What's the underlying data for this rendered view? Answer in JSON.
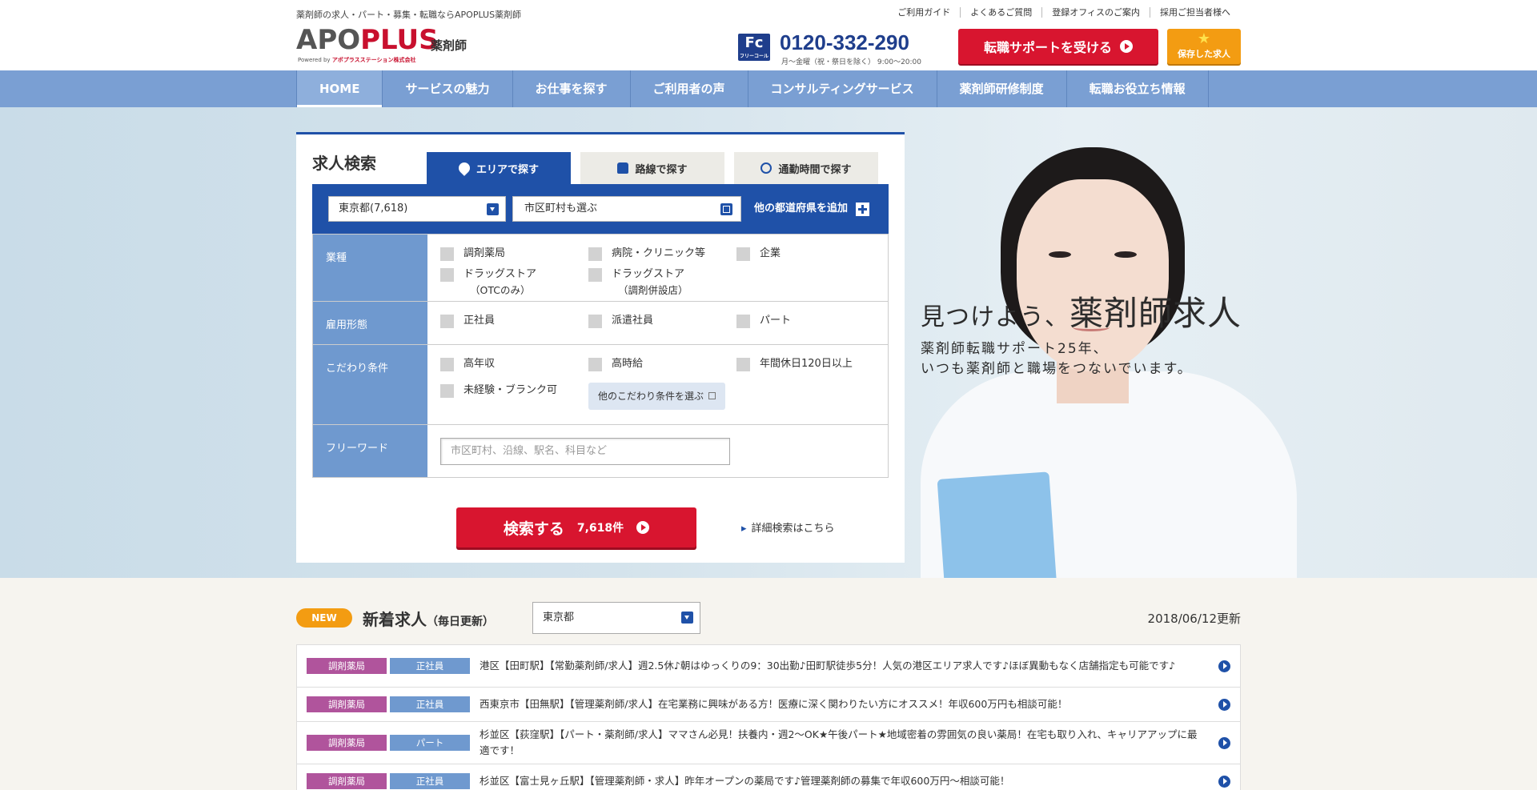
{
  "header": {
    "tagline": "薬剤師の求人・パート・募集・転職ならAPOPLUS薬剤師",
    "logo_prefix": "APO",
    "logo_plus": "PLUS",
    "logo_sub": "薬剤師",
    "logo_powered": "Powered by",
    "logo_company": "アポプラスステーション株式会社",
    "util_links": [
      "ご利用ガイド",
      "よくあるご質問",
      "登録オフィスのご案内",
      "採用ご担当者様へ"
    ],
    "phone_badge": "Fc",
    "phone_badge_sub": "フリーコール",
    "phone_number": "0120-332-290",
    "phone_hours": "月～金曜（祝・祭日を除く） 9:00～20:00",
    "support_button": "転職サポートを受ける",
    "saved_button": "保存した求人"
  },
  "nav": {
    "items": [
      "HOME",
      "サービスの魅力",
      "お仕事を探す",
      "ご利用者の声",
      "コンサルティングサービス",
      "薬剤師研修制度",
      "転職お役立ち情報"
    ]
  },
  "hero": {
    "catch_small": "見つけよう、",
    "catch_big": "薬剤師求人",
    "text_line1": "薬剤師転職サポート25年、",
    "text_line2": "いつも薬剤師と職場をつないでいます。"
  },
  "search": {
    "title": "求人検索",
    "tabs": [
      "エリアで探す",
      "路線で探す",
      "通勤時間で探す"
    ],
    "pref_value": "東京都(7,618)",
    "city_value": "市区町村も選ぶ",
    "add_pref": "他の都道府県を追加",
    "rows": {
      "industry": {
        "label": "業種",
        "options": [
          "調剤薬局",
          "病院・クリニック等",
          "企業",
          "ドラッグストア",
          "ドラッグストア"
        ],
        "option_subs": [
          "（OTCのみ）",
          "（調剤併設店）"
        ]
      },
      "employment": {
        "label": "雇用形態",
        "options": [
          "正社員",
          "派遣社員",
          "パート"
        ]
      },
      "preferences": {
        "label": "こだわり条件",
        "options": [
          "高年収",
          "高時給",
          "年間休日120日以上",
          "未経験・ブランク可"
        ],
        "more_button": "他のこだわり条件を選ぶ"
      },
      "freeword": {
        "label": "フリーワード",
        "placeholder": "市区町村、沿線、駅名、科目など"
      }
    },
    "submit_label": "検索する",
    "submit_count": "7,618件",
    "detail_link": "詳細検索はこちら"
  },
  "new_listings": {
    "badge": "NEW",
    "title": "新着求人",
    "title_sub": "（毎日更新）",
    "region_select": "東京都",
    "updated": "2018/06/12更新",
    "jobs": [
      {
        "type": "調剤薬局",
        "employment": "正社員",
        "text": "港区【田町駅】【常勤薬剤師/求人】週2.5休♪朝はゆっくりの9：30出勤♪田町駅徒歩5分！人気の港区エリア求人です♪ほぼ異動もなく店舗指定も可能です♪"
      },
      {
        "type": "調剤薬局",
        "employment": "正社員",
        "text": "西東京市【田無駅】【管理薬剤師/求人】在宅業務に興味がある方！医療に深く関わりたい方にオススメ！年収600万円も相談可能！"
      },
      {
        "type": "調剤薬局",
        "employment": "パート",
        "text": "杉並区【荻窪駅】【パート・薬剤師/求人】ママさん必見！扶養内・週2～OK★午後パート★地域密着の雰囲気の良い薬局！在宅も取り入れ、キャリアアップに最適です！"
      },
      {
        "type": "調剤薬局",
        "employment": "正社員",
        "text": "杉並区【富士見ヶ丘駅】【管理薬剤師・求人】昨年オープンの薬局です♪管理薬剤師の募集で年収600万円～相談可能！"
      }
    ]
  },
  "colors": {
    "brand_red": "#d8152f",
    "brand_blue": "#1f51a8",
    "nav_blue": "#7a9fd3",
    "accent_orange": "#f39c12",
    "tag_pharmacy": "#b0549c"
  }
}
